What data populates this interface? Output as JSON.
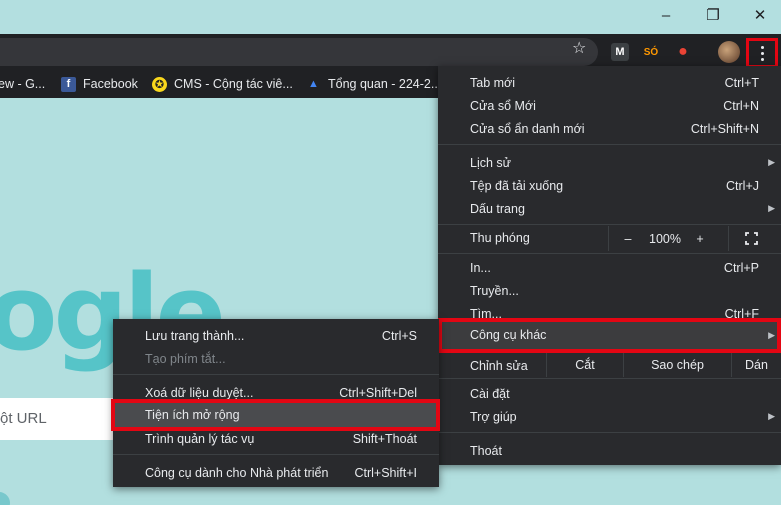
{
  "window": {
    "minimize": "–",
    "restore": "❐",
    "close": "✕"
  },
  "toolbar": {
    "star_icon": "☆",
    "extensions": [
      {
        "name": "mailtrack-icon",
        "glyph": "M",
        "bg": "#3c4043",
        "fg": "#ffffff"
      },
      {
        "name": "sale-icon",
        "glyph": "SÓ",
        "bg": "transparent",
        "fg": "#ff9800"
      },
      {
        "name": "red-circle-icon",
        "glyph": "●",
        "bg": "transparent",
        "fg": "#ea4335"
      }
    ]
  },
  "bookmarks": [
    {
      "label": "ew - G...",
      "icon": ""
    },
    {
      "label": "Facebook",
      "icon": "f"
    },
    {
      "label": "CMS - Cộng tác viê...",
      "icon": "✪"
    },
    {
      "label": "Tổng quan - 224-2...",
      "icon": "▲"
    }
  ],
  "page": {
    "logo_text": "ogle",
    "search_placeholder": "ột URL"
  },
  "menu": {
    "new_tab": {
      "label": "Tab mới",
      "shortcut": "Ctrl+T"
    },
    "new_window": {
      "label": "Cửa sổ Mới",
      "shortcut": "Ctrl+N"
    },
    "incognito": {
      "label": "Cửa sổ ẩn danh mới",
      "shortcut": "Ctrl+Shift+N"
    },
    "history": {
      "label": "Lịch sử"
    },
    "downloads": {
      "label": "Tệp đã tải xuống",
      "shortcut": "Ctrl+J"
    },
    "bookmarks": {
      "label": "Dấu trang"
    },
    "zoom": {
      "label": "Thu phóng",
      "minus": "–",
      "value": "100%",
      "plus": "+"
    },
    "print": {
      "label": "In...",
      "shortcut": "Ctrl+P"
    },
    "cast": {
      "label": "Truyền..."
    },
    "find": {
      "label": "Tìm...",
      "shortcut": "Ctrl+F"
    },
    "more_tools": {
      "label": "Công cụ khác"
    },
    "edit": {
      "label": "Chỉnh sửa",
      "cut": "Cắt",
      "copy": "Sao chép",
      "paste": "Dán"
    },
    "settings": {
      "label": "Cài đặt"
    },
    "help": {
      "label": "Trợ giúp"
    },
    "exit": {
      "label": "Thoát"
    }
  },
  "submenu": {
    "save_page": {
      "label": "Lưu trang thành...",
      "shortcut": "Ctrl+S"
    },
    "create_shortcut": {
      "label": "Tạo phím tắt..."
    },
    "clear_data": {
      "label": "Xoá dữ liệu duyệt...",
      "shortcut": "Ctrl+Shift+Del"
    },
    "extensions": {
      "label": "Tiện ích mở rộng"
    },
    "task_manager": {
      "label": "Trình quản lý tác vụ",
      "shortcut": "Shift+Thoát"
    },
    "dev_tools": {
      "label": "Công cụ dành cho Nhà phát triển",
      "shortcut": "Ctrl+Shift+I"
    }
  },
  "colors": {
    "highlight_border": "#e30613",
    "menu_bg": "#292a2d",
    "page_bg": "#b2dfdf"
  }
}
